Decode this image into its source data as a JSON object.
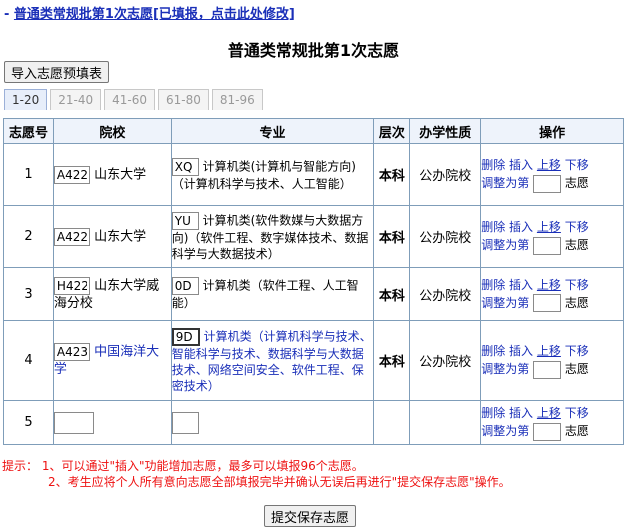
{
  "top_link": {
    "prefix": "- ",
    "text": "普通类常规批第1次志愿[已填报，点击此处修改]"
  },
  "page_title": {
    "before": "普通类常规批第",
    "num": "1",
    "after": "次志愿"
  },
  "import_button": "导入志愿预填表",
  "tabs": [
    {
      "label": "1-20",
      "active": true
    },
    {
      "label": "21-40",
      "active": false
    },
    {
      "label": "41-60",
      "active": false
    },
    {
      "label": "61-80",
      "active": false
    },
    {
      "label": "81-96",
      "active": false
    }
  ],
  "headers": {
    "no": "志愿号",
    "school": "院校",
    "major": "专业",
    "level": "层次",
    "nature": "办学性质",
    "ops": "操作"
  },
  "ops_labels": {
    "delete": "删除",
    "insert": "插入",
    "up": "上移",
    "down": "下移",
    "adjust_prefix": "调整为第",
    "adjust_suffix": "志愿"
  },
  "rows": [
    {
      "no": "1",
      "school_code": "A422",
      "school_name": "山东大学",
      "major_code": "XQ",
      "major_name": "计算机类(计算机与智能方向)（计算机科学与技术、人工智能）",
      "level": "本科",
      "nature": "公办院校"
    },
    {
      "no": "2",
      "school_code": "A422",
      "school_name": "山东大学",
      "major_code": "YU",
      "major_name": "计算机类(软件数媒与大数据方向)（软件工程、数字媒体技术、数据科学与大数据技术）",
      "level": "本科",
      "nature": "公办院校"
    },
    {
      "no": "3",
      "school_code": "H422",
      "school_name": "山东大学威海分校",
      "major_code": "0D",
      "major_name": "计算机类（软件工程、人工智能）",
      "level": "本科",
      "nature": "公办院校"
    },
    {
      "no": "4",
      "school_code": "A423",
      "school_name": "中国海洋大学",
      "major_code": "9D",
      "major_name": "计算机类（计算机科学与技术、智能科学与技术、数据科学与大数据技术、网络空间安全、软件工程、保密技术）",
      "level": "本科",
      "nature": "公办院校"
    },
    {
      "no": "5",
      "school_code": "",
      "school_name": "",
      "major_code": "",
      "major_name": "",
      "level": "",
      "nature": ""
    }
  ],
  "tips": {
    "label": "提示：",
    "line1": "1、可以通过\"插入\"功能增加志愿，最多可以填报96个志愿。",
    "line2": "2、考生应将个人所有意向志愿全部填报完毕并确认无误后再进行\"提交保存志愿\"操作。"
  },
  "save_button": "提交保存志愿",
  "colors": {
    "link": "#1a2fb8",
    "tip": "#e11111",
    "border": "#7f9db9"
  }
}
